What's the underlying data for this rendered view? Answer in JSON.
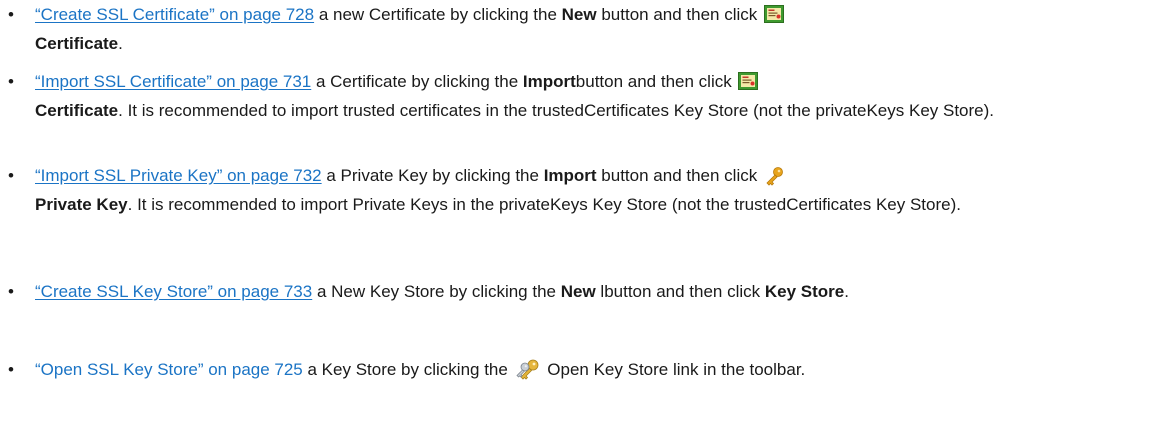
{
  "items": [
    {
      "link": "“Create SSL Certificate” on page 728",
      "pre": " a new Certificate by clicking the ",
      "bold1": "New",
      "mid": " button and then click ",
      "icon": "certificate-icon",
      "bold2": "Certificate",
      "post": "."
    },
    {
      "link": "“Import SSL Certificate” on page 731",
      "pre": " a Certificate by clicking the ",
      "bold1": "Import",
      "mid": "button and then click ",
      "icon": "certificate-icon",
      "bold2": "Certificate",
      "post": ". It is recommended to import trusted certificates in the trustedCertificates Key Store (not the privateKeys Key Store)."
    },
    {
      "link": "“Import SSL Private Key” on page 732",
      "pre": " a Private Key by clicking the ",
      "bold1": "Import",
      "mid": " button and then click ",
      "icon": "private-key-icon",
      "bold2": "Private Key",
      "post": ". It is recommended to import Private Keys in the privateKeys Key Store (not the trustedCertificates Key Store)."
    },
    {
      "link": "“Create SSL Key Store” on page 733",
      "pre": " a New Key Store by clicking the ",
      "bold1": "New",
      "mid": " lbutton and then click ",
      "bold2": "Key Store",
      "post": "."
    },
    {
      "link": "“Open SSL Key Store” on page 725",
      "pre": " a Key Store by clicking the ",
      "icon": "keys-icon",
      "post": " Open Key Store link in the toolbar."
    }
  ],
  "colors": {
    "link": "#1b74c5",
    "text": "#1a1a1a"
  }
}
